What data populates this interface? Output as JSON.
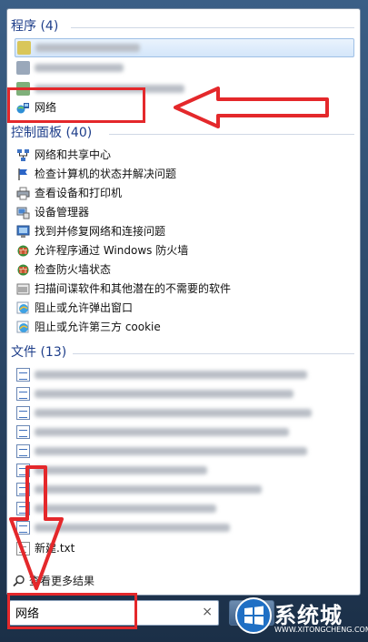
{
  "programs": {
    "header": "程序 (4)",
    "items": [
      {
        "type": "blurred",
        "icon": "app-icon",
        "selected": true
      },
      {
        "type": "blurred",
        "icon": "app-icon"
      },
      {
        "type": "blurred",
        "icon": "app-icon"
      },
      {
        "type": "text",
        "label": "网络",
        "icon": "network-icon"
      }
    ]
  },
  "control_panel": {
    "header": "控制面板 (40)",
    "items": [
      {
        "label": "网络和共享中心",
        "icon": "network-center-icon"
      },
      {
        "label": "检查计算机的状态并解决问题",
        "icon": "action-center-flag-icon"
      },
      {
        "label": "查看设备和打印机",
        "icon": "printer-icon"
      },
      {
        "label": "设备管理器",
        "icon": "device-manager-icon"
      },
      {
        "label": "找到并修复网络和连接问题",
        "icon": "troubleshoot-icon"
      },
      {
        "label": "允许程序通过 Windows 防火墙",
        "icon": "firewall-icon"
      },
      {
        "label": "检查防火墙状态",
        "icon": "firewall-icon"
      },
      {
        "label": "扫描间谍软件和其他潜在的不需要的软件",
        "icon": "defender-icon"
      },
      {
        "label": "阻止或允许弹出窗口",
        "icon": "internet-options-icon"
      },
      {
        "label": "阻止或允许第三方 cookie",
        "icon": "internet-options-icon"
      }
    ]
  },
  "files": {
    "header": "文件 (13)",
    "items": [
      {
        "type": "blurred",
        "icon": "document-icon"
      },
      {
        "type": "blurred",
        "icon": "document-icon"
      },
      {
        "type": "blurred",
        "icon": "document-icon"
      },
      {
        "type": "blurred",
        "icon": "document-icon"
      },
      {
        "type": "blurred",
        "icon": "document-icon"
      },
      {
        "type": "blurred",
        "icon": "document-icon"
      },
      {
        "type": "blurred",
        "icon": "document-icon"
      },
      {
        "type": "blurred",
        "icon": "document-icon"
      },
      {
        "type": "blurred",
        "icon": "document-icon"
      },
      {
        "type": "text",
        "label": "新建.txt",
        "icon": "text-file-icon"
      }
    ]
  },
  "see_more": {
    "label": "查看更多结果",
    "icon": "search-icon"
  },
  "search": {
    "value": "网络",
    "clear_icon": "close-icon",
    "clear_glyph": "×"
  },
  "watermark": {
    "title": "系统城",
    "url": "WWW.XITONGCHENG.COM"
  },
  "colors": {
    "annotation": "#e4282b",
    "header_text": "#1e3e8a",
    "selection": "#d4e6fa"
  }
}
